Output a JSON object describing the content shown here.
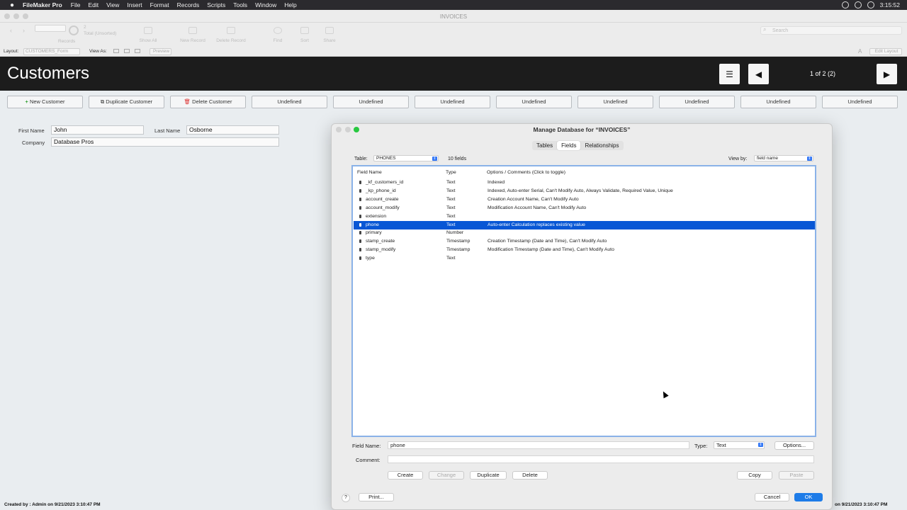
{
  "menubar": {
    "app_name": "FileMaker Pro",
    "items": [
      "File",
      "Edit",
      "View",
      "Insert",
      "Format",
      "Records",
      "Scripts",
      "Tools",
      "Window",
      "Help"
    ],
    "time": "3:15:52"
  },
  "window": {
    "title": "INVOICES"
  },
  "toolbar": {
    "record_count": "2",
    "total_label": "Total (Unsorted)",
    "records_label": "Records",
    "show_all": "Show All",
    "new_record": "New Record",
    "delete_record": "Delete Record",
    "find": "Find",
    "sort": "Sort",
    "share": "Share",
    "search_placeholder": "Search"
  },
  "layoutbar": {
    "layout_label": "Layout:",
    "layout_value": "CUSTOMERS_Form",
    "view_as": "View As:",
    "preview": "Preview",
    "edit_layout": "Edit Layout",
    "font_glyph": "A"
  },
  "header": {
    "title": "Customers",
    "record_info": "1 of 2 (2)"
  },
  "actions": [
    {
      "icon": "+",
      "label": "New Customer"
    },
    {
      "icon": "⧉",
      "label": "Duplicate Customer"
    },
    {
      "icon": "🗑",
      "label": "Delete Customer"
    },
    {
      "label": "Undefined"
    },
    {
      "label": "Undefined"
    },
    {
      "label": "Undefined"
    },
    {
      "label": "Undefined"
    },
    {
      "label": "Undefined"
    },
    {
      "label": "Undefined"
    },
    {
      "label": "Undefined"
    },
    {
      "label": "Undefined"
    }
  ],
  "form": {
    "first_name_label": "First Name",
    "first_name": "John",
    "last_name_label": "Last Name",
    "last_name": "Osborne",
    "company_label": "Company",
    "company": "Database Pros"
  },
  "status": {
    "left": "Created by : Admin on 9/21/2023 3:10:47 PM",
    "right": "on 9/21/2023 3:10:47 PM"
  },
  "dialog": {
    "title": "Manage Database for “INVOICES”",
    "tabs": [
      "Tables",
      "Fields",
      "Relationships"
    ],
    "active_tab": "Fields",
    "table_label": "Table:",
    "table_value": "PHONES",
    "field_count": "10 fields",
    "view_by_label": "View by:",
    "view_by_value": "field name",
    "columns": [
      "Field Name",
      "Type",
      "Options / Comments   (Click to toggle)"
    ],
    "fields": [
      {
        "name": "_kf_customers_id",
        "type": "Text",
        "options": "Indexed"
      },
      {
        "name": "_kp_phone_id",
        "type": "Text",
        "options": "Indexed, Auto-enter Serial, Can't Modify Auto, Always Validate, Required Value, Unique"
      },
      {
        "name": "account_create",
        "type": "Text",
        "options": "Creation Account Name, Can't Modify Auto"
      },
      {
        "name": "account_modify",
        "type": "Text",
        "options": "Modification Account Name, Can't Modify Auto"
      },
      {
        "name": "extension",
        "type": "Text",
        "options": ""
      },
      {
        "name": "phone",
        "type": "Text",
        "options": "Auto-enter Calculation replaces existing value"
      },
      {
        "name": "primary",
        "type": "Number",
        "options": ""
      },
      {
        "name": "stamp_create",
        "type": "Timestamp",
        "options": "Creation Timestamp (Date and Time), Can't Modify Auto"
      },
      {
        "name": "stamp_modify",
        "type": "Timestamp",
        "options": "Modification Timestamp (Date and Time), Can't Modify Auto"
      },
      {
        "name": "type",
        "type": "Text",
        "options": ""
      }
    ],
    "selected_field": "phone",
    "field_name_label": "Field Name:",
    "field_name_value": "phone",
    "type_label": "Type:",
    "type_value": "Text",
    "options_btn": "Options...",
    "comment_label": "Comment:",
    "comment_value": "",
    "create_btn": "Create",
    "change_btn": "Change",
    "duplicate_btn": "Duplicate",
    "delete_btn": "Delete",
    "copy_btn": "Copy",
    "paste_btn": "Paste",
    "help": "?",
    "print_btn": "Print...",
    "cancel_btn": "Cancel",
    "ok_btn": "OK"
  },
  "colors": {
    "selection": "#0857d5",
    "header_bg": "#1c1c1c",
    "ok_button": "#1e7ce8"
  }
}
